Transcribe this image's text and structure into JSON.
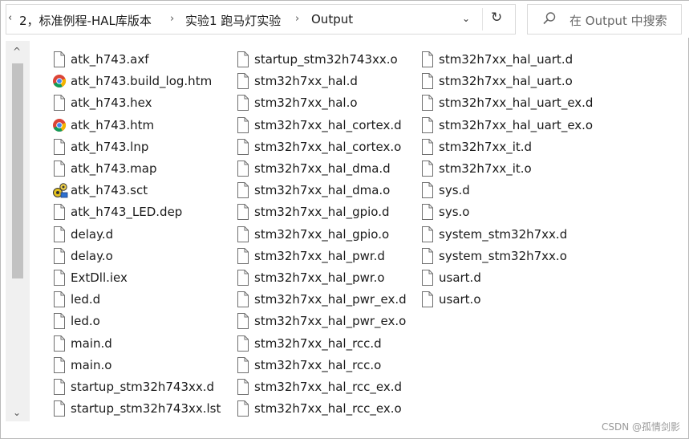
{
  "address_bar": {
    "left_fragment": "‹",
    "crumbs": [
      "2，标准例程-HAL库版本",
      "实验1 跑马灯实验",
      "Output"
    ],
    "separator": "›",
    "dropdown_glyph": "⌄",
    "refresh_glyph": "↻"
  },
  "search": {
    "placeholder": "在 Output 中搜索"
  },
  "scrollbar": {
    "up_glyph": "^",
    "down_glyph": "⌄"
  },
  "files": {
    "col1": [
      {
        "name": "atk_h743.axf",
        "icon": "document-icon"
      },
      {
        "name": "atk_h743.build_log.htm",
        "icon": "chrome-icon"
      },
      {
        "name": "atk_h743.hex",
        "icon": "document-icon"
      },
      {
        "name": "atk_h743.htm",
        "icon": "chrome-icon"
      },
      {
        "name": "atk_h743.lnp",
        "icon": "document-icon"
      },
      {
        "name": "atk_h743.map",
        "icon": "document-icon"
      },
      {
        "name": "atk_h743.sct",
        "icon": "config-gears-icon"
      },
      {
        "name": "atk_h743_LED.dep",
        "icon": "document-icon"
      },
      {
        "name": "delay.d",
        "icon": "document-icon"
      },
      {
        "name": "delay.o",
        "icon": "document-icon"
      },
      {
        "name": "ExtDll.iex",
        "icon": "document-icon"
      },
      {
        "name": "led.d",
        "icon": "document-icon"
      },
      {
        "name": "led.o",
        "icon": "document-icon"
      },
      {
        "name": "main.d",
        "icon": "document-icon"
      },
      {
        "name": "main.o",
        "icon": "document-icon"
      },
      {
        "name": "startup_stm32h743xx.d",
        "icon": "document-icon"
      },
      {
        "name": "startup_stm32h743xx.lst",
        "icon": "document-icon"
      }
    ],
    "col2": [
      {
        "name": "startup_stm32h743xx.o",
        "icon": "document-icon"
      },
      {
        "name": "stm32h7xx_hal.d",
        "icon": "document-icon"
      },
      {
        "name": "stm32h7xx_hal.o",
        "icon": "document-icon"
      },
      {
        "name": "stm32h7xx_hal_cortex.d",
        "icon": "document-icon"
      },
      {
        "name": "stm32h7xx_hal_cortex.o",
        "icon": "document-icon"
      },
      {
        "name": "stm32h7xx_hal_dma.d",
        "icon": "document-icon"
      },
      {
        "name": "stm32h7xx_hal_dma.o",
        "icon": "document-icon"
      },
      {
        "name": "stm32h7xx_hal_gpio.d",
        "icon": "document-icon"
      },
      {
        "name": "stm32h7xx_hal_gpio.o",
        "icon": "document-icon"
      },
      {
        "name": "stm32h7xx_hal_pwr.d",
        "icon": "document-icon"
      },
      {
        "name": "stm32h7xx_hal_pwr.o",
        "icon": "document-icon"
      },
      {
        "name": "stm32h7xx_hal_pwr_ex.d",
        "icon": "document-icon"
      },
      {
        "name": "stm32h7xx_hal_pwr_ex.o",
        "icon": "document-icon"
      },
      {
        "name": "stm32h7xx_hal_rcc.d",
        "icon": "document-icon"
      },
      {
        "name": "stm32h7xx_hal_rcc.o",
        "icon": "document-icon"
      },
      {
        "name": "stm32h7xx_hal_rcc_ex.d",
        "icon": "document-icon"
      },
      {
        "name": "stm32h7xx_hal_rcc_ex.o",
        "icon": "document-icon"
      }
    ],
    "col3": [
      {
        "name": "stm32h7xx_hal_uart.d",
        "icon": "document-icon"
      },
      {
        "name": "stm32h7xx_hal_uart.o",
        "icon": "document-icon"
      },
      {
        "name": "stm32h7xx_hal_uart_ex.d",
        "icon": "document-icon"
      },
      {
        "name": "stm32h7xx_hal_uart_ex.o",
        "icon": "document-icon"
      },
      {
        "name": "stm32h7xx_it.d",
        "icon": "document-icon"
      },
      {
        "name": "stm32h7xx_it.o",
        "icon": "document-icon"
      },
      {
        "name": "sys.d",
        "icon": "document-icon"
      },
      {
        "name": "sys.o",
        "icon": "document-icon"
      },
      {
        "name": "system_stm32h7xx.d",
        "icon": "document-icon"
      },
      {
        "name": "system_stm32h7xx.o",
        "icon": "document-icon"
      },
      {
        "name": "usart.d",
        "icon": "document-icon"
      },
      {
        "name": "usart.o",
        "icon": "document-icon"
      }
    ]
  },
  "watermark": "CSDN @孤情剑影",
  "colors": {
    "scroll_track": "#f0f0f0",
    "scroll_thumb": "#c2c2c2",
    "border": "#d9d9d9"
  }
}
